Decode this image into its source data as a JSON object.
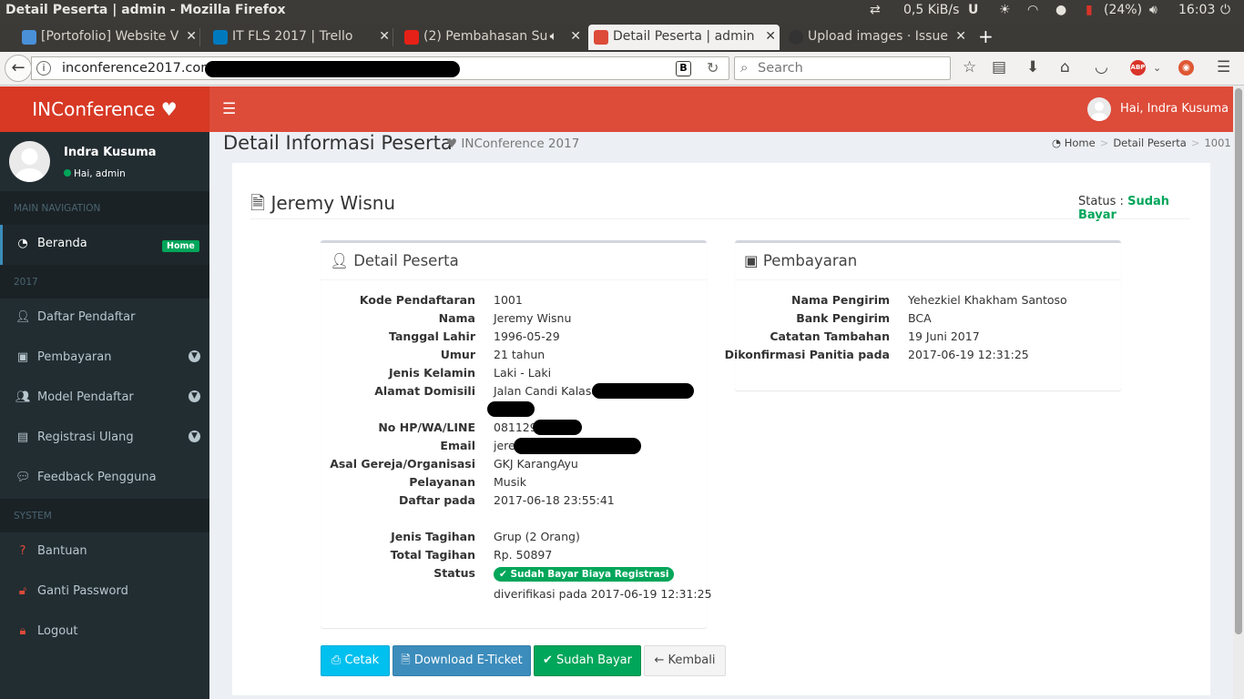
{
  "system": {
    "window_title": "Detail Peserta | admin - Mozilla Firefox",
    "net_speed": "0,5 KiB/s",
    "battery": "(24%)",
    "time": "16:03"
  },
  "browser": {
    "tabs": [
      {
        "label": "[Portofolio] Website V",
        "favicon_color": "#4a90d9"
      },
      {
        "label": "IT FLS 2017 | Trello",
        "favicon_color": "#0079bf"
      },
      {
        "label": "(2) Pembahasan Su",
        "favicon_color": "#e62117"
      },
      {
        "label": "Detail Peserta | admin",
        "favicon_color": "#dd4b39"
      },
      {
        "label": "Upload images · Issue",
        "favicon_color": "#333333"
      }
    ],
    "url": "inconference2017.com",
    "search_placeholder": "Search",
    "abp_label": "ABP"
  },
  "app": {
    "brand": "INConference",
    "topbar_user": "Hai, Indra Kusuma",
    "colors": {
      "brand": "#dd4b39",
      "sidebar": "#222d32",
      "success": "#00a65a",
      "info": "#00c0ef",
      "primary": "#3c8dbc"
    }
  },
  "sidebar": {
    "user_name": "Indra Kusuma",
    "user_status": "Hai, admin",
    "header_main": "MAIN NAVIGATION",
    "header_2017": "2017",
    "header_system": "SYSTEM",
    "items": [
      {
        "label": "Beranda",
        "icon": "dashboard-icon",
        "badge": "Home"
      },
      {
        "label": "Daftar Pendaftar",
        "icon": "user-plus-icon"
      },
      {
        "label": "Pembayaran",
        "icon": "money-icon"
      },
      {
        "label": "Model Pendaftar",
        "icon": "users-icon"
      },
      {
        "label": "Registrasi Ulang",
        "icon": "id-card-icon"
      },
      {
        "label": "Feedback Pengguna",
        "icon": "comment-icon"
      },
      {
        "label": "Bantuan",
        "icon": "question-icon"
      },
      {
        "label": "Ganti Password",
        "icon": "unlock-icon"
      },
      {
        "label": "Logout",
        "icon": "lock-icon"
      }
    ]
  },
  "page": {
    "title": "Detail Informasi Peserta",
    "subtitle": "INConference 2017",
    "breadcrumb": [
      "Home",
      "Detail Peserta",
      "1001"
    ],
    "participant_name": "Jeremy Wisnu",
    "status_label": "Status :",
    "status_value": "Sudah Bayar"
  },
  "detail": {
    "title": "Detail Peserta",
    "rows": [
      {
        "k": "Kode Pendaftaran",
        "v": "1001"
      },
      {
        "k": "Nama",
        "v": "Jeremy Wisnu"
      },
      {
        "k": "Tanggal Lahir",
        "v": "1996-05-29"
      },
      {
        "k": "Umur",
        "v": "21 tahun"
      },
      {
        "k": "Jenis Kelamin",
        "v": "Laki - Laki"
      },
      {
        "k": "Alamat Domisili",
        "v": "Jalan Candi Kalasa"
      },
      {
        "k": "No HP/WA/LINE",
        "v": "081129"
      },
      {
        "k": "Email",
        "v": "jere"
      },
      {
        "k": "Asal Gereja/Organisasi",
        "v": "GKJ KarangAyu"
      },
      {
        "k": "Pelayanan",
        "v": "Musik"
      },
      {
        "k": "Daftar pada",
        "v": "2017-06-18 23:55:41"
      },
      {
        "k": "Jenis Tagihan",
        "v": "Grup (2 Orang)"
      },
      {
        "k": "Total Tagihan",
        "v": "Rp. 50897"
      },
      {
        "k": "Status",
        "v": "Sudah Bayar Biaya Registrasi"
      }
    ],
    "verified": "diverifikasi pada 2017-06-19 12:31:25"
  },
  "payment": {
    "title": "Pembayaran",
    "rows": [
      {
        "k": "Nama Pengirim",
        "v": "Yehezkiel Khakham Santoso"
      },
      {
        "k": "Bank Pengirim",
        "v": "BCA"
      },
      {
        "k": "Catatan Tambahan",
        "v": "19 Juni 2017"
      },
      {
        "k": "Dikonfirmasi Panitia pada",
        "v": "2017-06-19 12:31:25"
      }
    ]
  },
  "actions": {
    "print": "Cetak",
    "download": "Download E-Ticket",
    "paid": "Sudah Bayar",
    "back": "Kembali"
  }
}
